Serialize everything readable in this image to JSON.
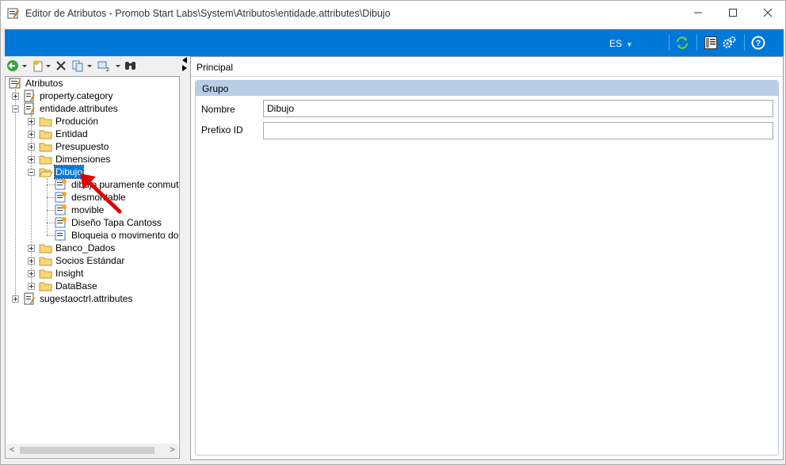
{
  "window": {
    "title": "Editor de Atributos - Promob Start Labs\\System\\Atributos\\entidade.attributes\\Dibujo"
  },
  "ribbon": {
    "language": "ES",
    "accent": "#0078d7"
  },
  "tree": {
    "root": "Atributos",
    "items": [
      {
        "label": "property.category"
      },
      {
        "label": "entidade.attributes"
      },
      {
        "label": "Produción"
      },
      {
        "label": "Entidad"
      },
      {
        "label": "Presupuesto"
      },
      {
        "label": "Dimensiones"
      },
      {
        "label": "Dibujo"
      },
      {
        "label": "dibujo puramente conmutable"
      },
      {
        "label": "desmontable"
      },
      {
        "label": "movible"
      },
      {
        "label": "Diseño Tapa Cantoss"
      },
      {
        "label": "Bloqueia o movimento do ei"
      },
      {
        "label": "Banco_Dados"
      },
      {
        "label": "Socios Estándar"
      },
      {
        "label": "Insight"
      },
      {
        "label": "DataBase"
      },
      {
        "label": "sugestaoctrl.attributes"
      }
    ]
  },
  "details": {
    "tab": "Principal",
    "group_title": "Grupo",
    "fields": {
      "nombre_label": "Nombre",
      "nombre_value": "Dibujo",
      "prefijo_label": "Prefixo ID",
      "prefijo_value": ""
    }
  }
}
